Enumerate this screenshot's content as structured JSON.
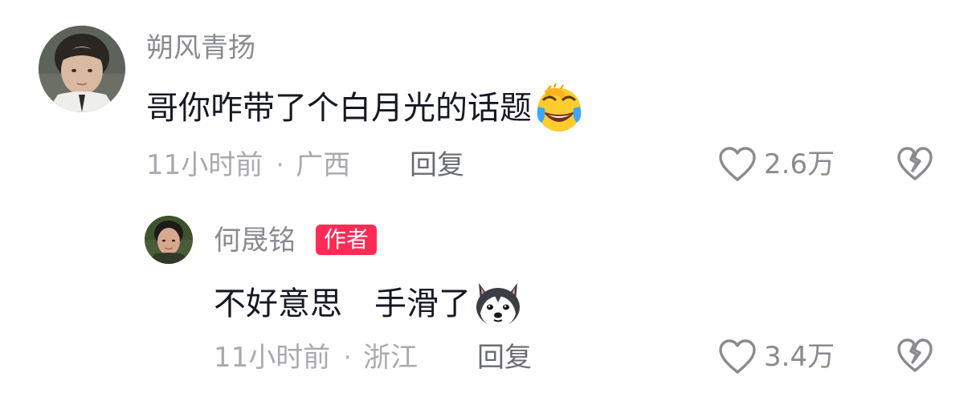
{
  "comments": [
    {
      "username": "朔风青扬",
      "text": "哥你咋带了个白月光的话题",
      "emoji": "laughing-crying-emoji",
      "time": "11小时前",
      "separator": "·",
      "location": "广西",
      "reply_label": "回复",
      "likes": "2.6万"
    },
    {
      "username": "何晟铭",
      "badge": "作者",
      "text": "不好意思　手滑了",
      "emoji": "husky-dog-emoji",
      "time": "11小时前",
      "separator": "·",
      "location": "浙江",
      "reply_label": "回复",
      "likes": "3.4万"
    }
  ],
  "icons": {
    "like": "heart-outline-icon",
    "dislike": "broken-heart-icon"
  },
  "colors": {
    "author_badge": "#fe2c55",
    "username": "#8a8b91",
    "meta": "#a9aab0"
  }
}
